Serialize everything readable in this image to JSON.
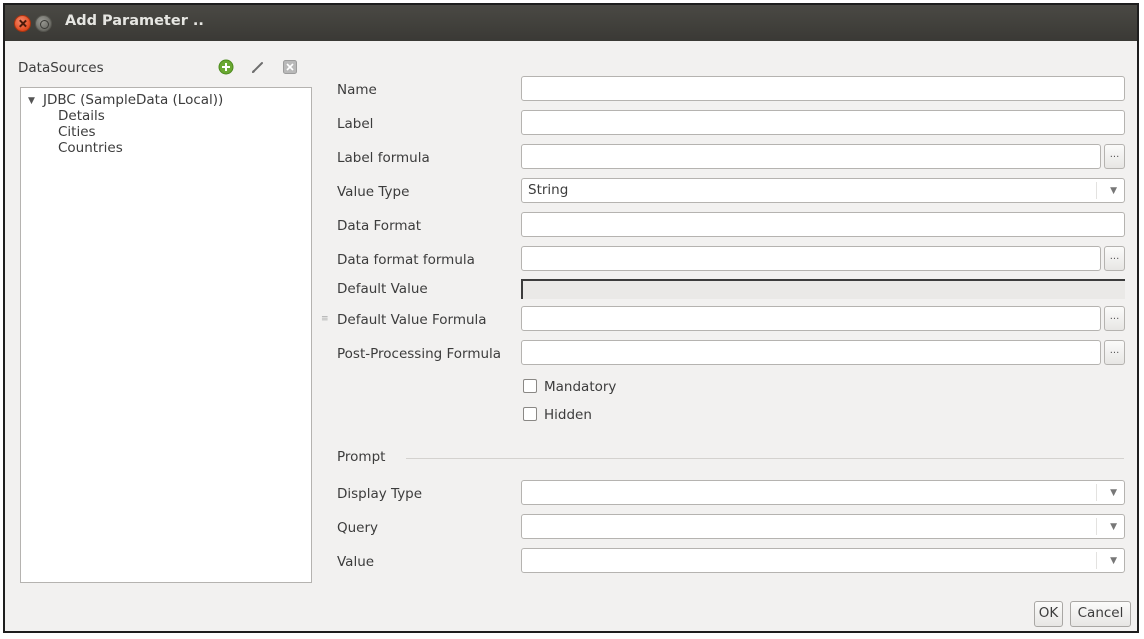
{
  "window": {
    "title": "Add Parameter .."
  },
  "datasources": {
    "label": "DataSources",
    "tree": {
      "root": "JDBC (SampleData (Local))",
      "children": [
        "Details",
        "Cities",
        "Countries"
      ]
    }
  },
  "form": {
    "name_label": "Name",
    "name_value": "",
    "label_label": "Label",
    "label_value": "",
    "label_formula_label": "Label formula",
    "label_formula_value": "",
    "value_type_label": "Value Type",
    "value_type_value": "String",
    "data_format_label": "Data Format",
    "data_format_value": "",
    "data_format_formula_label": "Data format formula",
    "data_format_formula_value": "",
    "default_value_label": "Default Value",
    "default_value_formula_label": "Default Value Formula",
    "default_value_formula_value": "",
    "post_processing_formula_label": "Post-Processing Formula",
    "post_processing_formula_value": "",
    "ellipsis": "...",
    "mandatory_label": "Mandatory",
    "mandatory_checked": false,
    "hidden_label": "Hidden",
    "hidden_checked": false
  },
  "prompt": {
    "section_label": "Prompt",
    "display_type_label": "Display Type",
    "display_type_value": "",
    "query_label": "Query",
    "query_value": "",
    "value_label": "Value",
    "value_value": ""
  },
  "buttons": {
    "ok": "OK",
    "cancel": "Cancel"
  },
  "colors": {
    "titlebar": "#3c3b37",
    "close_button": "#df4a20",
    "add_icon": "#5c9e2a",
    "window_bg": "#f2f1f0"
  },
  "icons": [
    "close-icon",
    "minimize-icon",
    "add-datasource-icon",
    "edit-icon",
    "delete-icon",
    "tree-expand-icon",
    "chevron-down-icon"
  ]
}
